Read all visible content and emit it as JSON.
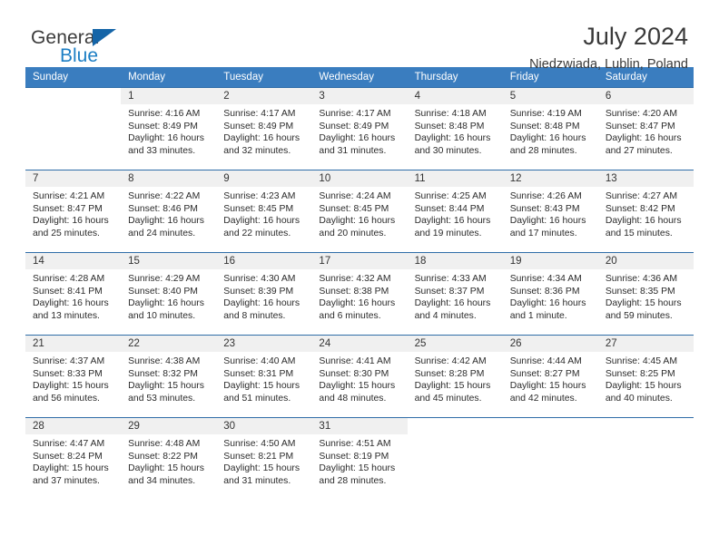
{
  "brand": {
    "name_part1": "General",
    "name_part2": "Blue",
    "triangle_color": "#1565a8",
    "blue_color": "#1c7ec4"
  },
  "header": {
    "title": "July 2024",
    "subtitle": "Niedzwiada, Lublin, Poland"
  },
  "calendar": {
    "header_bg": "#3a7dbf",
    "daynum_bg": "#f0f0f0",
    "weekdays": [
      "Sunday",
      "Monday",
      "Tuesday",
      "Wednesday",
      "Thursday",
      "Friday",
      "Saturday"
    ],
    "weeks": [
      [
        {
          "day": "",
          "sunrise": "",
          "sunset": "",
          "daylight": ""
        },
        {
          "day": "1",
          "sunrise": "Sunrise: 4:16 AM",
          "sunset": "Sunset: 8:49 PM",
          "daylight": "Daylight: 16 hours and 33 minutes."
        },
        {
          "day": "2",
          "sunrise": "Sunrise: 4:17 AM",
          "sunset": "Sunset: 8:49 PM",
          "daylight": "Daylight: 16 hours and 32 minutes."
        },
        {
          "day": "3",
          "sunrise": "Sunrise: 4:17 AM",
          "sunset": "Sunset: 8:49 PM",
          "daylight": "Daylight: 16 hours and 31 minutes."
        },
        {
          "day": "4",
          "sunrise": "Sunrise: 4:18 AM",
          "sunset": "Sunset: 8:48 PM",
          "daylight": "Daylight: 16 hours and 30 minutes."
        },
        {
          "day": "5",
          "sunrise": "Sunrise: 4:19 AM",
          "sunset": "Sunset: 8:48 PM",
          "daylight": "Daylight: 16 hours and 28 minutes."
        },
        {
          "day": "6",
          "sunrise": "Sunrise: 4:20 AM",
          "sunset": "Sunset: 8:47 PM",
          "daylight": "Daylight: 16 hours and 27 minutes."
        }
      ],
      [
        {
          "day": "7",
          "sunrise": "Sunrise: 4:21 AM",
          "sunset": "Sunset: 8:47 PM",
          "daylight": "Daylight: 16 hours and 25 minutes."
        },
        {
          "day": "8",
          "sunrise": "Sunrise: 4:22 AM",
          "sunset": "Sunset: 8:46 PM",
          "daylight": "Daylight: 16 hours and 24 minutes."
        },
        {
          "day": "9",
          "sunrise": "Sunrise: 4:23 AM",
          "sunset": "Sunset: 8:45 PM",
          "daylight": "Daylight: 16 hours and 22 minutes."
        },
        {
          "day": "10",
          "sunrise": "Sunrise: 4:24 AM",
          "sunset": "Sunset: 8:45 PM",
          "daylight": "Daylight: 16 hours and 20 minutes."
        },
        {
          "day": "11",
          "sunrise": "Sunrise: 4:25 AM",
          "sunset": "Sunset: 8:44 PM",
          "daylight": "Daylight: 16 hours and 19 minutes."
        },
        {
          "day": "12",
          "sunrise": "Sunrise: 4:26 AM",
          "sunset": "Sunset: 8:43 PM",
          "daylight": "Daylight: 16 hours and 17 minutes."
        },
        {
          "day": "13",
          "sunrise": "Sunrise: 4:27 AM",
          "sunset": "Sunset: 8:42 PM",
          "daylight": "Daylight: 16 hours and 15 minutes."
        }
      ],
      [
        {
          "day": "14",
          "sunrise": "Sunrise: 4:28 AM",
          "sunset": "Sunset: 8:41 PM",
          "daylight": "Daylight: 16 hours and 13 minutes."
        },
        {
          "day": "15",
          "sunrise": "Sunrise: 4:29 AM",
          "sunset": "Sunset: 8:40 PM",
          "daylight": "Daylight: 16 hours and 10 minutes."
        },
        {
          "day": "16",
          "sunrise": "Sunrise: 4:30 AM",
          "sunset": "Sunset: 8:39 PM",
          "daylight": "Daylight: 16 hours and 8 minutes."
        },
        {
          "day": "17",
          "sunrise": "Sunrise: 4:32 AM",
          "sunset": "Sunset: 8:38 PM",
          "daylight": "Daylight: 16 hours and 6 minutes."
        },
        {
          "day": "18",
          "sunrise": "Sunrise: 4:33 AM",
          "sunset": "Sunset: 8:37 PM",
          "daylight": "Daylight: 16 hours and 4 minutes."
        },
        {
          "day": "19",
          "sunrise": "Sunrise: 4:34 AM",
          "sunset": "Sunset: 8:36 PM",
          "daylight": "Daylight: 16 hours and 1 minute."
        },
        {
          "day": "20",
          "sunrise": "Sunrise: 4:36 AM",
          "sunset": "Sunset: 8:35 PM",
          "daylight": "Daylight: 15 hours and 59 minutes."
        }
      ],
      [
        {
          "day": "21",
          "sunrise": "Sunrise: 4:37 AM",
          "sunset": "Sunset: 8:33 PM",
          "daylight": "Daylight: 15 hours and 56 minutes."
        },
        {
          "day": "22",
          "sunrise": "Sunrise: 4:38 AM",
          "sunset": "Sunset: 8:32 PM",
          "daylight": "Daylight: 15 hours and 53 minutes."
        },
        {
          "day": "23",
          "sunrise": "Sunrise: 4:40 AM",
          "sunset": "Sunset: 8:31 PM",
          "daylight": "Daylight: 15 hours and 51 minutes."
        },
        {
          "day": "24",
          "sunrise": "Sunrise: 4:41 AM",
          "sunset": "Sunset: 8:30 PM",
          "daylight": "Daylight: 15 hours and 48 minutes."
        },
        {
          "day": "25",
          "sunrise": "Sunrise: 4:42 AM",
          "sunset": "Sunset: 8:28 PM",
          "daylight": "Daylight: 15 hours and 45 minutes."
        },
        {
          "day": "26",
          "sunrise": "Sunrise: 4:44 AM",
          "sunset": "Sunset: 8:27 PM",
          "daylight": "Daylight: 15 hours and 42 minutes."
        },
        {
          "day": "27",
          "sunrise": "Sunrise: 4:45 AM",
          "sunset": "Sunset: 8:25 PM",
          "daylight": "Daylight: 15 hours and 40 minutes."
        }
      ],
      [
        {
          "day": "28",
          "sunrise": "Sunrise: 4:47 AM",
          "sunset": "Sunset: 8:24 PM",
          "daylight": "Daylight: 15 hours and 37 minutes."
        },
        {
          "day": "29",
          "sunrise": "Sunrise: 4:48 AM",
          "sunset": "Sunset: 8:22 PM",
          "daylight": "Daylight: 15 hours and 34 minutes."
        },
        {
          "day": "30",
          "sunrise": "Sunrise: 4:50 AM",
          "sunset": "Sunset: 8:21 PM",
          "daylight": "Daylight: 15 hours and 31 minutes."
        },
        {
          "day": "31",
          "sunrise": "Sunrise: 4:51 AM",
          "sunset": "Sunset: 8:19 PM",
          "daylight": "Daylight: 15 hours and 28 minutes."
        },
        {
          "day": "",
          "sunrise": "",
          "sunset": "",
          "daylight": ""
        },
        {
          "day": "",
          "sunrise": "",
          "sunset": "",
          "daylight": ""
        },
        {
          "day": "",
          "sunrise": "",
          "sunset": "",
          "daylight": ""
        }
      ]
    ]
  }
}
